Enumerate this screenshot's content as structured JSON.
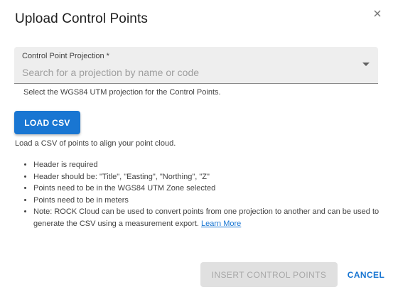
{
  "dialog": {
    "title": "Upload Control Points",
    "close_icon": "close-icon"
  },
  "projection_field": {
    "label": "Control Point Projection *",
    "placeholder": "Search for a projection by name or code",
    "value": "",
    "icon": "chevron-down-icon",
    "hint": "Select the WGS84 UTM projection for the Control Points."
  },
  "load_csv": {
    "button_label": "LOAD CSV",
    "description": "Load a CSV of points to align your point cloud."
  },
  "requirements": {
    "items": [
      "Header is required",
      "Header should be: \"Title\", \"Easting\", \"Northing\", \"Z\"",
      "Points need to be in the WGS84 UTM Zone selected",
      "Points need to be in meters",
      "Note: ROCK Cloud can be used to convert points from one projection to another and can be used to generate the CSV using a measurement export."
    ],
    "learn_more_label": "Learn More"
  },
  "actions": {
    "insert_label": "INSERT CONTROL POINTS",
    "insert_enabled": false,
    "cancel_label": "CANCEL"
  },
  "colors": {
    "accent": "#1976d2",
    "field_bg": "#eeeeee",
    "disabled_bg": "#e0e0e0",
    "disabled_text": "#a8a8a8"
  }
}
